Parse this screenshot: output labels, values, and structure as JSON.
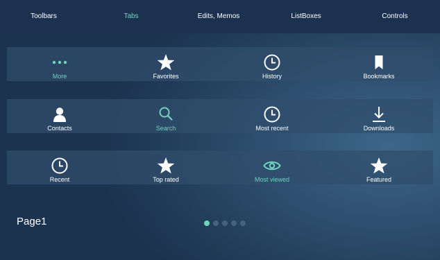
{
  "top_tabs": [
    {
      "label": "Toolbars"
    },
    {
      "label": "Tabs"
    },
    {
      "label": "Edits, Memos"
    },
    {
      "label": "ListBoxes"
    },
    {
      "label": "Controls"
    }
  ],
  "active_top_tab": "Tabs",
  "rows": [
    [
      {
        "label": "More",
        "icon": "more-dots-icon"
      },
      {
        "label": "Favorites",
        "icon": "star-icon"
      },
      {
        "label": "History",
        "icon": "clock-icon"
      },
      {
        "label": "Bookmarks",
        "icon": "bookmark-icon"
      }
    ],
    [
      {
        "label": "Contacts",
        "icon": "person-icon"
      },
      {
        "label": "Search",
        "icon": "search-icon"
      },
      {
        "label": "Most recent",
        "icon": "clock-icon"
      },
      {
        "label": "Downloads",
        "icon": "download-icon"
      }
    ],
    [
      {
        "label": "Recent",
        "icon": "clock-icon"
      },
      {
        "label": "Top rated",
        "icon": "star-icon"
      },
      {
        "label": "Most viewed",
        "icon": "eye-icon"
      },
      {
        "label": "Featured",
        "icon": "star-icon"
      }
    ]
  ],
  "active_tabs": [
    "More",
    "Search",
    "Most viewed"
  ],
  "page": {
    "label": "Page1",
    "total_pages": 5,
    "current_page": 1
  },
  "colors": {
    "accent": "#6fd3bd",
    "topbar": "#1c3150",
    "strip": "#304e6c",
    "dot_inactive": "#46627e"
  }
}
